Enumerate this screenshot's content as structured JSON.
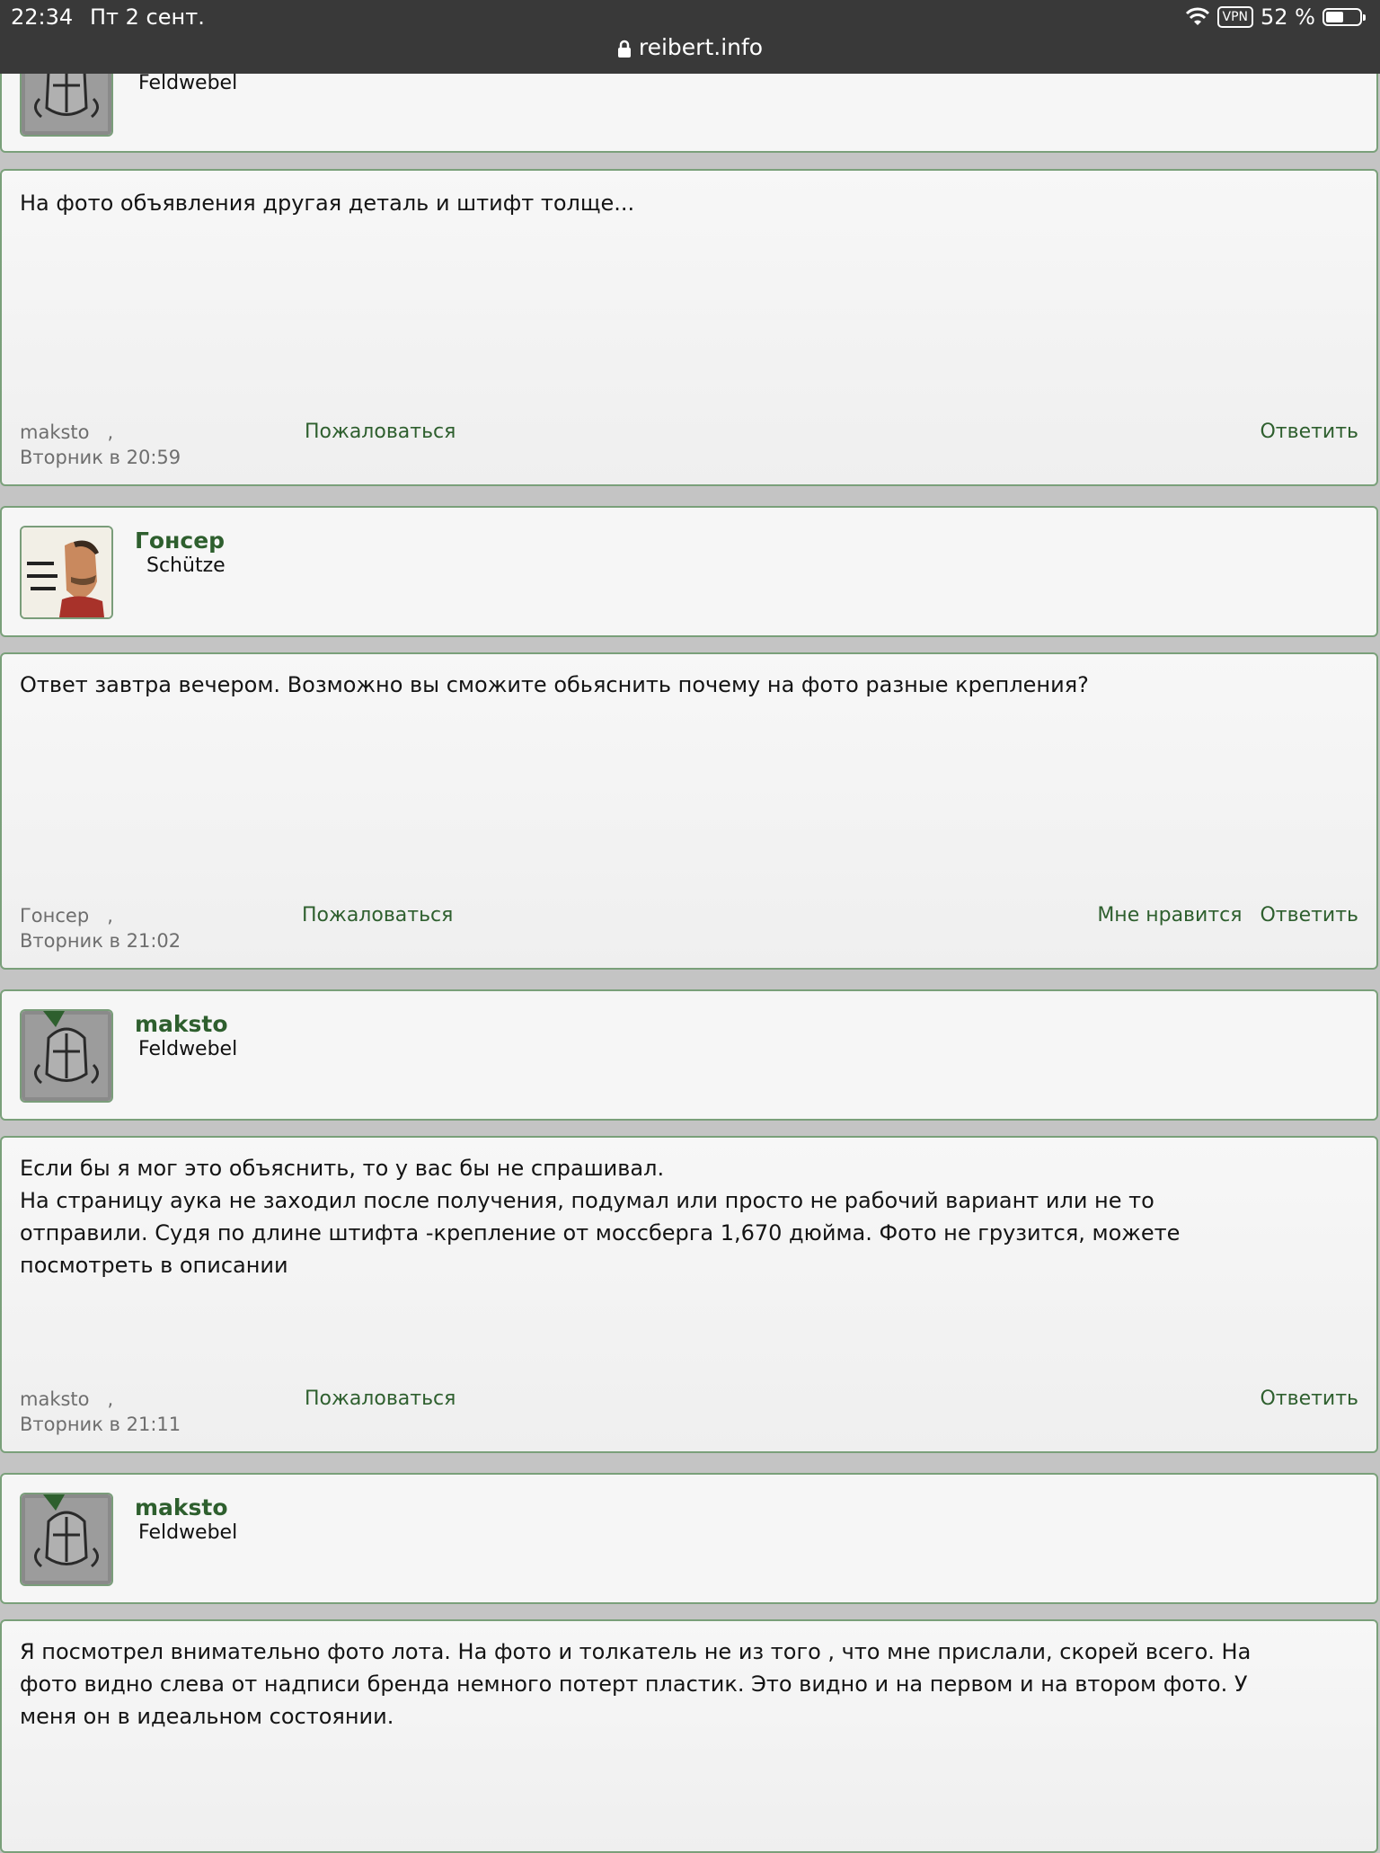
{
  "status": {
    "time": "22:34",
    "date": "Пт 2 сент.",
    "vpn": "VPN",
    "battery": "52 %",
    "battery_level": 0.52,
    "url": "reibert.info"
  },
  "blocks": {
    "top_rank": "Feldwebel",
    "p1": {
      "text": "На фото объявления другая деталь и штифт толще...",
      "user": "maksto",
      "time": "Вторник в 20:59",
      "report": "Пожаловаться",
      "reply": "Ответить"
    },
    "a2": {
      "name": "Гонсер",
      "rank": "Schütze"
    },
    "p2": {
      "text": "Ответ завтра вечером. Возможно вы сможите обьяснить почему на фото разные крепления?",
      "user": "Гонсер",
      "time": "Вторник в 21:02",
      "report": "Пожаловаться",
      "like": "Мне нравится",
      "reply": "Ответить"
    },
    "a3": {
      "name": "maksto",
      "rank": "Feldwebel"
    },
    "p3": {
      "lines": [
        "Если бы я мог это объяснить, то у вас бы не спрашивал.",
        "На страницу аука не заходил после получения, подумал или просто не рабочий вариант или не то",
        "отправили. Судя по длине штифта -крепление от моссберга 1,670 дюйма. Фото не грузится, можете",
        "посмотреть в описании"
      ],
      "user": "maksto",
      "time": "Вторник в 21:11",
      "report": "Пожаловаться",
      "reply": "Ответить"
    },
    "a4": {
      "name": "maksto",
      "rank": "Feldwebel"
    },
    "p4": {
      "lines": [
        "Я посмотрел внимательно фото лота. На фото и толкатель не из того , что мне прислали, скорей всего. На",
        "фото видно слева от надписи бренда немного потерт пластик. Это видно и на первом и на втором фото. У",
        "меня он в идеальном состоянии."
      ]
    }
  },
  "colors": {
    "accent": "#2e5f2e",
    "border": "#7aa07a",
    "status_bar": "#393939"
  },
  "icons": {
    "wifi": "wifi-icon",
    "lock": "lock-icon",
    "battery": "battery-icon"
  }
}
